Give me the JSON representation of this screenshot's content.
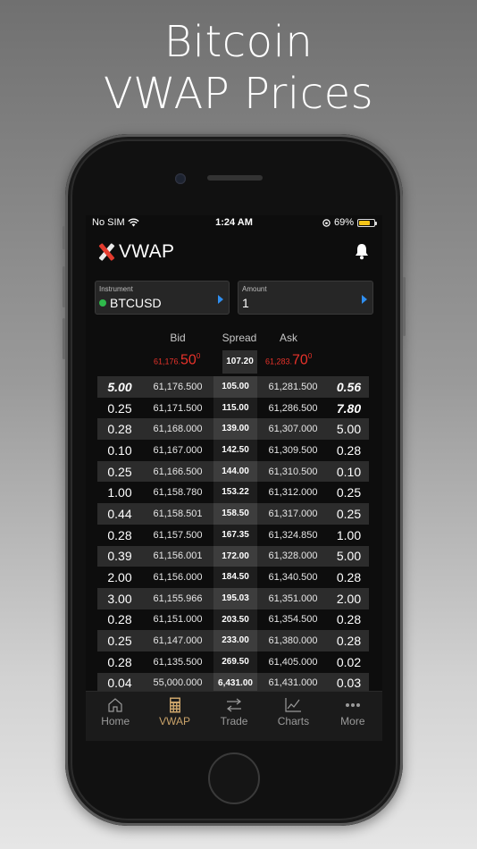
{
  "headline": {
    "line1": "Bitcoin",
    "line2": "VWAP Prices"
  },
  "status_bar": {
    "carrier": "No SIM",
    "time": "1:24 AM",
    "battery": "69%",
    "battery_level": 0.69
  },
  "app": {
    "title": "VWAP",
    "bell_icon": "bell-icon"
  },
  "instrument": {
    "label": "Instrument",
    "value": "BTCUSD",
    "status_color": "#2fb94b"
  },
  "amount": {
    "label": "Amount",
    "value": "1"
  },
  "columns": {
    "bid": "Bid",
    "spread": "Spread",
    "ask": "Ask"
  },
  "top": {
    "bid_small": "61,176.",
    "bid_large": "50",
    "bid_sup": "0",
    "spread": "107.20",
    "ask_small": "61,283.",
    "ask_large": "70",
    "ask_sup": "0",
    "accent_color": "#e7322a"
  },
  "rows": [
    {
      "bid_volume": "5.00",
      "bid": "61,176.500",
      "spread": "105.00",
      "ask": "61,281.500",
      "ask_volume": "0.56"
    },
    {
      "bid_volume": "0.25",
      "bid": "61,171.500",
      "spread": "115.00",
      "ask": "61,286.500",
      "ask_volume": "7.80"
    },
    {
      "bid_volume": "0.28",
      "bid": "61,168.000",
      "spread": "139.00",
      "ask": "61,307.000",
      "ask_volume": "5.00"
    },
    {
      "bid_volume": "0.10",
      "bid": "61,167.000",
      "spread": "142.50",
      "ask": "61,309.500",
      "ask_volume": "0.28"
    },
    {
      "bid_volume": "0.25",
      "bid": "61,166.500",
      "spread": "144.00",
      "ask": "61,310.500",
      "ask_volume": "0.10"
    },
    {
      "bid_volume": "1.00",
      "bid": "61,158.780",
      "spread": "153.22",
      "ask": "61,312.000",
      "ask_volume": "0.25"
    },
    {
      "bid_volume": "0.44",
      "bid": "61,158.501",
      "spread": "158.50",
      "ask": "61,317.000",
      "ask_volume": "0.25"
    },
    {
      "bid_volume": "0.28",
      "bid": "61,157.500",
      "spread": "167.35",
      "ask": "61,324.850",
      "ask_volume": "1.00"
    },
    {
      "bid_volume": "0.39",
      "bid": "61,156.001",
      "spread": "172.00",
      "ask": "61,328.000",
      "ask_volume": "5.00"
    },
    {
      "bid_volume": "2.00",
      "bid": "61,156.000",
      "spread": "184.50",
      "ask": "61,340.500",
      "ask_volume": "0.28"
    },
    {
      "bid_volume": "3.00",
      "bid": "61,155.966",
      "spread": "195.03",
      "ask": "61,351.000",
      "ask_volume": "2.00"
    },
    {
      "bid_volume": "0.28",
      "bid": "61,151.000",
      "spread": "203.50",
      "ask": "61,354.500",
      "ask_volume": "0.28"
    },
    {
      "bid_volume": "0.25",
      "bid": "61,147.000",
      "spread": "233.00",
      "ask": "61,380.000",
      "ask_volume": "0.28"
    },
    {
      "bid_volume": "0.28",
      "bid": "61,135.500",
      "spread": "269.50",
      "ask": "61,405.000",
      "ask_volume": "0.02"
    },
    {
      "bid_volume": "0.04",
      "bid": "55,000.000",
      "spread": "6,431.00",
      "ask": "61,431.000",
      "ask_volume": "0.03"
    }
  ],
  "tabs": [
    {
      "label": "Home",
      "icon": "home-icon"
    },
    {
      "label": "VWAP",
      "icon": "calculator-icon",
      "active": true
    },
    {
      "label": "Trade",
      "icon": "arrows-icon"
    },
    {
      "label": "Charts",
      "icon": "chart-icon"
    },
    {
      "label": "More",
      "icon": "more-icon"
    }
  ],
  "colors": {
    "active_tab": "#caa36a",
    "link_arrow": "#2f8ef0"
  }
}
